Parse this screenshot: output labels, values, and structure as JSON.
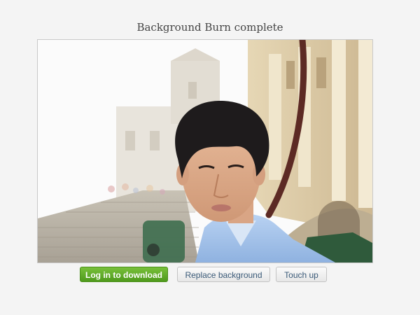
{
  "header": {
    "title": "Background Burn complete"
  },
  "photo": {
    "subject": "result-photo"
  },
  "actions": {
    "download_label": "Log in to download",
    "replace_label": "Replace background",
    "touchup_label": "Touch up"
  },
  "colors": {
    "primary_button": "#5aa823",
    "secondary_text": "#3a5a78",
    "page_background": "#f4f4f4"
  }
}
